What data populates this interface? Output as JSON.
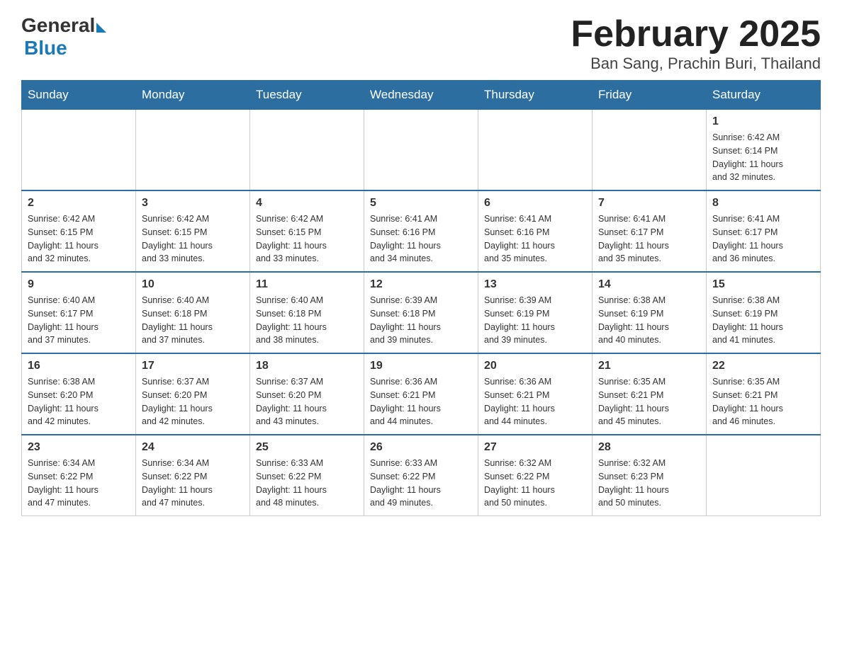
{
  "header": {
    "logo_general": "General",
    "logo_blue": "Blue",
    "title": "February 2025",
    "subtitle": "Ban Sang, Prachin Buri, Thailand"
  },
  "weekdays": [
    "Sunday",
    "Monday",
    "Tuesday",
    "Wednesday",
    "Thursday",
    "Friday",
    "Saturday"
  ],
  "weeks": [
    [
      {
        "day": "",
        "info": ""
      },
      {
        "day": "",
        "info": ""
      },
      {
        "day": "",
        "info": ""
      },
      {
        "day": "",
        "info": ""
      },
      {
        "day": "",
        "info": ""
      },
      {
        "day": "",
        "info": ""
      },
      {
        "day": "1",
        "info": "Sunrise: 6:42 AM\nSunset: 6:14 PM\nDaylight: 11 hours\nand 32 minutes."
      }
    ],
    [
      {
        "day": "2",
        "info": "Sunrise: 6:42 AM\nSunset: 6:15 PM\nDaylight: 11 hours\nand 32 minutes."
      },
      {
        "day": "3",
        "info": "Sunrise: 6:42 AM\nSunset: 6:15 PM\nDaylight: 11 hours\nand 33 minutes."
      },
      {
        "day": "4",
        "info": "Sunrise: 6:42 AM\nSunset: 6:15 PM\nDaylight: 11 hours\nand 33 minutes."
      },
      {
        "day": "5",
        "info": "Sunrise: 6:41 AM\nSunset: 6:16 PM\nDaylight: 11 hours\nand 34 minutes."
      },
      {
        "day": "6",
        "info": "Sunrise: 6:41 AM\nSunset: 6:16 PM\nDaylight: 11 hours\nand 35 minutes."
      },
      {
        "day": "7",
        "info": "Sunrise: 6:41 AM\nSunset: 6:17 PM\nDaylight: 11 hours\nand 35 minutes."
      },
      {
        "day": "8",
        "info": "Sunrise: 6:41 AM\nSunset: 6:17 PM\nDaylight: 11 hours\nand 36 minutes."
      }
    ],
    [
      {
        "day": "9",
        "info": "Sunrise: 6:40 AM\nSunset: 6:17 PM\nDaylight: 11 hours\nand 37 minutes."
      },
      {
        "day": "10",
        "info": "Sunrise: 6:40 AM\nSunset: 6:18 PM\nDaylight: 11 hours\nand 37 minutes."
      },
      {
        "day": "11",
        "info": "Sunrise: 6:40 AM\nSunset: 6:18 PM\nDaylight: 11 hours\nand 38 minutes."
      },
      {
        "day": "12",
        "info": "Sunrise: 6:39 AM\nSunset: 6:18 PM\nDaylight: 11 hours\nand 39 minutes."
      },
      {
        "day": "13",
        "info": "Sunrise: 6:39 AM\nSunset: 6:19 PM\nDaylight: 11 hours\nand 39 minutes."
      },
      {
        "day": "14",
        "info": "Sunrise: 6:38 AM\nSunset: 6:19 PM\nDaylight: 11 hours\nand 40 minutes."
      },
      {
        "day": "15",
        "info": "Sunrise: 6:38 AM\nSunset: 6:19 PM\nDaylight: 11 hours\nand 41 minutes."
      }
    ],
    [
      {
        "day": "16",
        "info": "Sunrise: 6:38 AM\nSunset: 6:20 PM\nDaylight: 11 hours\nand 42 minutes."
      },
      {
        "day": "17",
        "info": "Sunrise: 6:37 AM\nSunset: 6:20 PM\nDaylight: 11 hours\nand 42 minutes."
      },
      {
        "day": "18",
        "info": "Sunrise: 6:37 AM\nSunset: 6:20 PM\nDaylight: 11 hours\nand 43 minutes."
      },
      {
        "day": "19",
        "info": "Sunrise: 6:36 AM\nSunset: 6:21 PM\nDaylight: 11 hours\nand 44 minutes."
      },
      {
        "day": "20",
        "info": "Sunrise: 6:36 AM\nSunset: 6:21 PM\nDaylight: 11 hours\nand 44 minutes."
      },
      {
        "day": "21",
        "info": "Sunrise: 6:35 AM\nSunset: 6:21 PM\nDaylight: 11 hours\nand 45 minutes."
      },
      {
        "day": "22",
        "info": "Sunrise: 6:35 AM\nSunset: 6:21 PM\nDaylight: 11 hours\nand 46 minutes."
      }
    ],
    [
      {
        "day": "23",
        "info": "Sunrise: 6:34 AM\nSunset: 6:22 PM\nDaylight: 11 hours\nand 47 minutes."
      },
      {
        "day": "24",
        "info": "Sunrise: 6:34 AM\nSunset: 6:22 PM\nDaylight: 11 hours\nand 47 minutes."
      },
      {
        "day": "25",
        "info": "Sunrise: 6:33 AM\nSunset: 6:22 PM\nDaylight: 11 hours\nand 48 minutes."
      },
      {
        "day": "26",
        "info": "Sunrise: 6:33 AM\nSunset: 6:22 PM\nDaylight: 11 hours\nand 49 minutes."
      },
      {
        "day": "27",
        "info": "Sunrise: 6:32 AM\nSunset: 6:22 PM\nDaylight: 11 hours\nand 50 minutes."
      },
      {
        "day": "28",
        "info": "Sunrise: 6:32 AM\nSunset: 6:23 PM\nDaylight: 11 hours\nand 50 minutes."
      },
      {
        "day": "",
        "info": ""
      }
    ]
  ]
}
